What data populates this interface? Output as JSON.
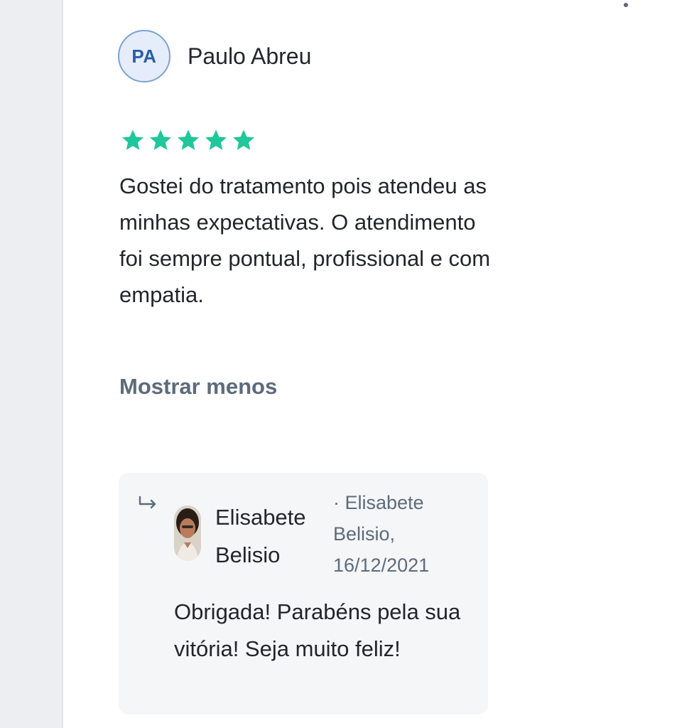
{
  "menu": {
    "icon": "more-vertical-icon"
  },
  "review": {
    "initials": "PA",
    "author": "Paulo Abreu",
    "rating": 5,
    "rating_max": 5,
    "star_color": "#1fc79a",
    "text": "Gostei do tratamento pois atendeu as minhas expectativas. O atendimento foi sempre pontual, profissional e com empatia.",
    "toggle_label": "Mostrar menos"
  },
  "reply": {
    "icon": "reply-arrow-icon",
    "author": "Elisabete Belisio",
    "meta": "· Elisabete Belisio, 16/12/2021",
    "text": "Obrigada! Parabéns pela sua vitória! Seja muito feliz!"
  }
}
